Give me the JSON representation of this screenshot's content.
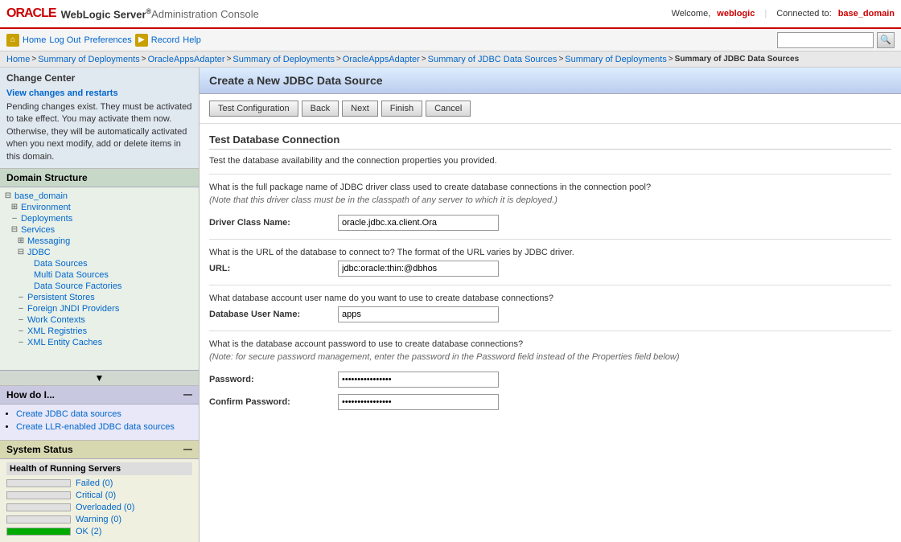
{
  "header": {
    "oracle_text": "ORACLE",
    "product_name": "WebLogic Server",
    "sup_mark": "®",
    "console_title": " Administration Console",
    "welcome_label": "Welcome, ",
    "welcome_user": "weblogic",
    "connected_label": "Connected to: ",
    "connected_domain": "base_domain"
  },
  "navbar": {
    "home_label": "Home",
    "logout_label": "Log Out",
    "preferences_label": "Preferences",
    "record_label": "Record",
    "help_label": "Help",
    "search_placeholder": ""
  },
  "breadcrumb": {
    "items": [
      "Home",
      "Summary of Deployments",
      "OracleAppsAdapter",
      "Summary of Deployments",
      "OracleAppsAdapter",
      "Summary of JDBC Data Sources",
      "Summary of Deployments",
      "Summary of JDBC Data Sources"
    ],
    "current": "Summary of JDBC Data Sources"
  },
  "change_center": {
    "title": "Change Center",
    "view_changes_label": "View changes and restarts",
    "description": "Pending changes exist. They must be activated to take effect. You may activate them now. Otherwise, they will be automatically activated when you next modify, add or delete items in this domain."
  },
  "domain_structure": {
    "title": "Domain Structure",
    "root": "base_domain",
    "items": [
      {
        "label": "Environment",
        "indent": 1,
        "expandable": true
      },
      {
        "label": "Deployments",
        "indent": 1,
        "expandable": false
      },
      {
        "label": "Services",
        "indent": 1,
        "expandable": true
      },
      {
        "label": "Messaging",
        "indent": 2,
        "expandable": true
      },
      {
        "label": "JDBC",
        "indent": 2,
        "expandable": true
      },
      {
        "label": "Data Sources",
        "indent": 3,
        "expandable": false
      },
      {
        "label": "Multi Data Sources",
        "indent": 3,
        "expandable": false
      },
      {
        "label": "Data Source Factories",
        "indent": 3,
        "expandable": false
      },
      {
        "label": "Persistent Stores",
        "indent": 2,
        "expandable": false
      },
      {
        "label": "Foreign JNDI Providers",
        "indent": 2,
        "expandable": false
      },
      {
        "label": "Work Contexts",
        "indent": 2,
        "expandable": false
      },
      {
        "label": "XML Registries",
        "indent": 2,
        "expandable": false
      },
      {
        "label": "XML Entity Caches",
        "indent": 2,
        "expandable": false
      }
    ]
  },
  "how_do_i": {
    "title": "How do I...",
    "links": [
      "Create JDBC data sources",
      "Create LLR-enabled JDBC data sources"
    ]
  },
  "system_status": {
    "title": "System Status",
    "health_label": "Health of Running Servers",
    "statuses": [
      {
        "label": "Failed (0)",
        "fill_pct": 0,
        "color": "red"
      },
      {
        "label": "Critical (0)",
        "fill_pct": 0,
        "color": "orange"
      },
      {
        "label": "Overloaded (0)",
        "fill_pct": 0,
        "color": "yellow"
      },
      {
        "label": "Warning (0)",
        "fill_pct": 0,
        "color": "yellow"
      },
      {
        "label": "OK (2)",
        "fill_pct": 100,
        "color": "green"
      }
    ]
  },
  "page": {
    "title": "Create a New JDBC Data Source",
    "buttons": {
      "test_config": "Test Configuration",
      "back": "Back",
      "next": "Next",
      "finish": "Finish",
      "cancel": "Cancel"
    },
    "section_title": "Test Database Connection",
    "intro_text": "Test the database availability and the connection properties you provided.",
    "driver_question": "What is the full package name of JDBC driver class used to create database connections in the connection pool?",
    "driver_note": "(Note that this driver class must be in the classpath of any server to which it is deployed.)",
    "driver_label": "Driver Class Name:",
    "driver_value": "oracle.jdbc.xa.client.Ora",
    "url_question": "What is the URL of the database to connect to? The format of the URL varies by JDBC driver.",
    "url_label": "URL:",
    "url_value": "jdbc:oracle:thin:@dbhos",
    "username_question": "What database account user name do you want to use to create database connections?",
    "username_label": "Database User Name:",
    "username_value": "apps",
    "password_question": "What is the database account password to use to create database connections?",
    "password_note": "(Note: for secure password management, enter the password in the Password field instead of the Properties field below)",
    "password_label": "Password:",
    "password_value": "••••••••••••••••",
    "confirm_password_label": "Confirm Password:",
    "confirm_password_value": "••••••••••••••••"
  }
}
